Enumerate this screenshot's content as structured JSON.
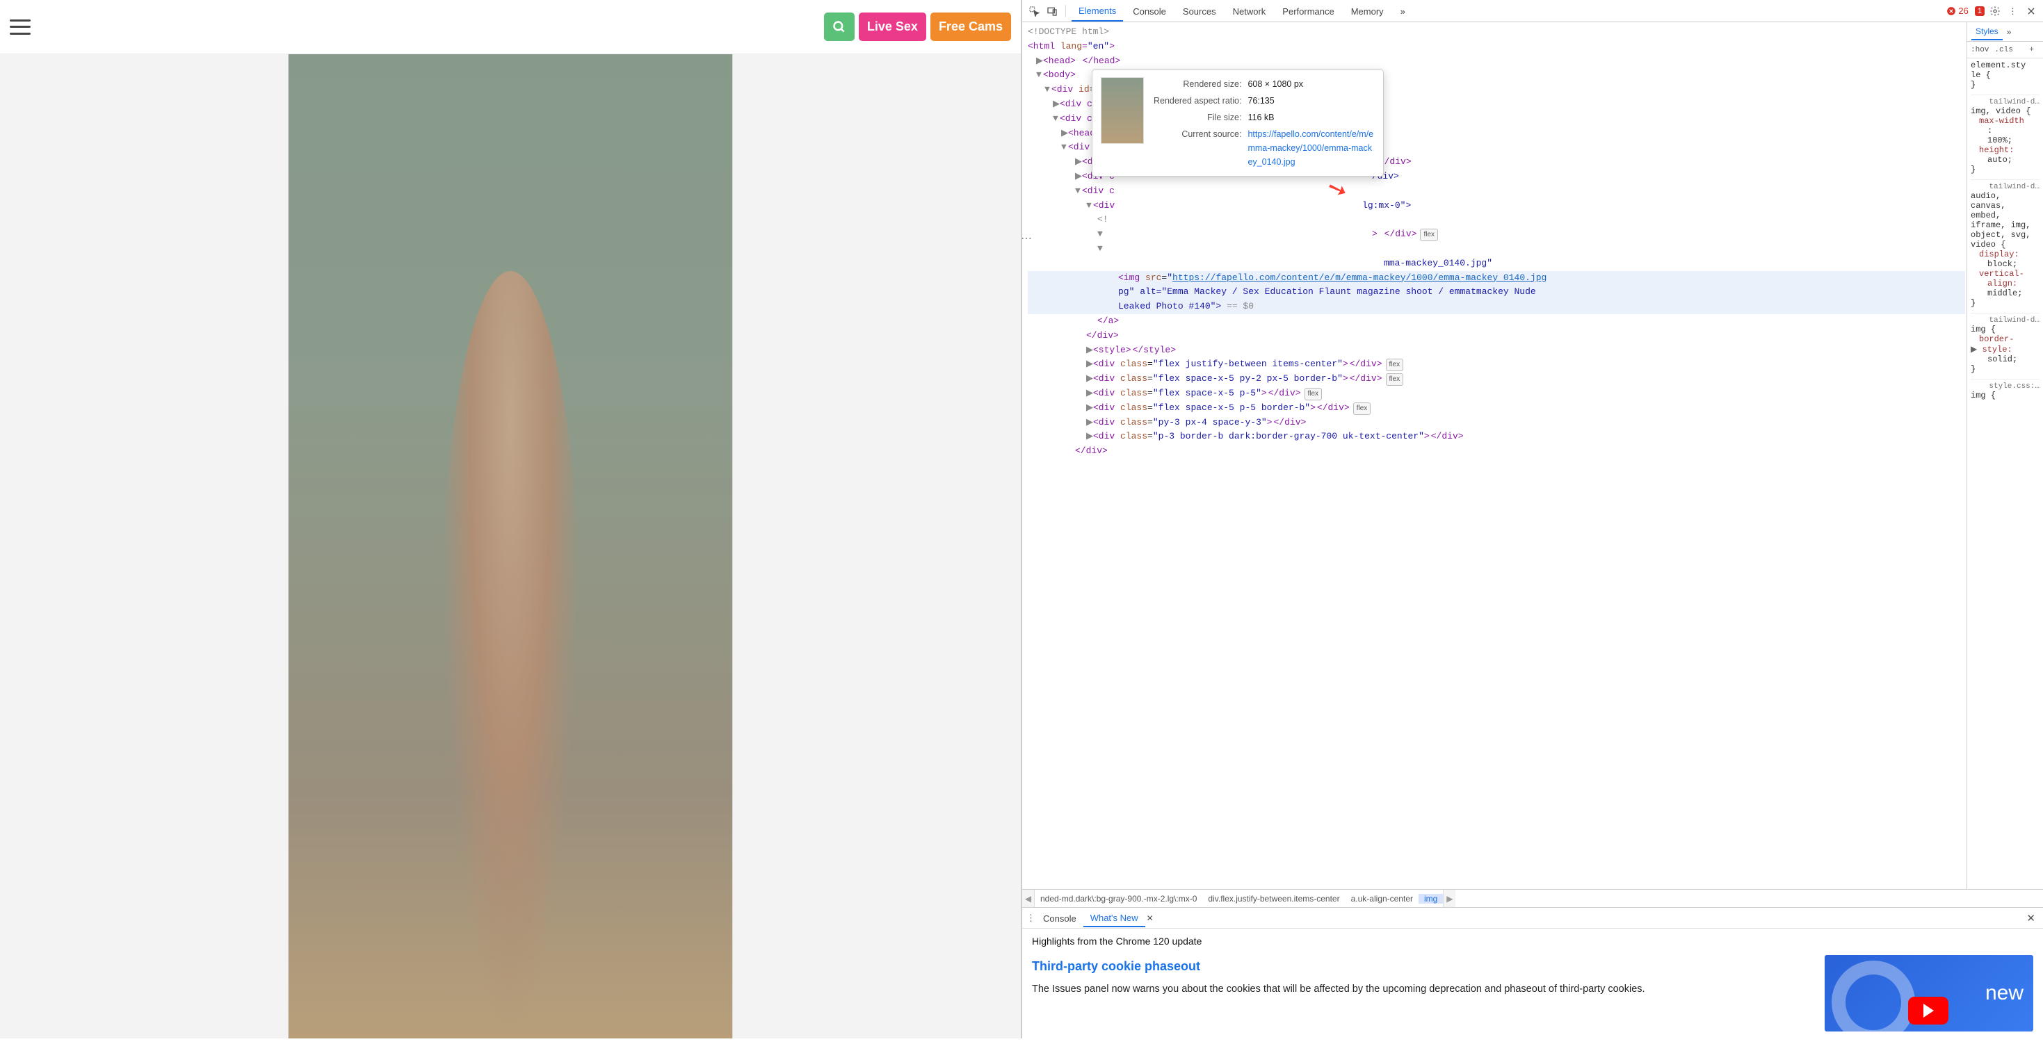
{
  "topbar": {
    "live_sex": "Live Sex",
    "free_cams": "Free Cams"
  },
  "devtools": {
    "tabs": [
      "Elements",
      "Console",
      "Sources",
      "Network",
      "Performance",
      "Memory"
    ],
    "active_tab": "Elements",
    "more": "»",
    "error_count": "26",
    "warn_count": "1",
    "styles_tab": "Styles",
    "hov": ":hov",
    "cls": ".cls"
  },
  "tooltip": {
    "rendered_size_k": "Rendered size:",
    "rendered_size_v": "608 × 1080 px",
    "aspect_k": "Rendered aspect ratio:",
    "aspect_v": "76:135",
    "filesize_k": "File size:",
    "filesize_v": "116 kB",
    "source_k": "Current source:",
    "source_v": "https://fapello.com/content/e/m/emma-mackey/1000/emma-mackey_0140.jpg"
  },
  "dom": {
    "doctype": "<!DOCTYPE html>",
    "html_open": "<html lang=\"en\">",
    "head": "<head>  </head>",
    "body_open": "<body>",
    "wrapper": "<div id=\"wrapper\">",
    "div_clas": "<div clas",
    "header": "<header>  </header>",
    "div_cl": "<div cl",
    "div_c": "<div c",
    "div_end": "</div>",
    "lg_mx": "lg:mx-0\">",
    "cut_comment": "<!",
    "after_flex": "> </div>",
    "mackey_trail": "mma-mackey_0140.jpg\"",
    "img_open": "<img src=\"",
    "img_url": "https://fapello.com/content/e/m/emma-mackey/1000/emma-mackey_0140.jpg",
    "img_alt_1": "\" alt=\"Emma Mackey / Sex Education Flaunt magazine shoot / emmatmackey Nude",
    "img_alt_2": "Leaked  Photo #140\"> ",
    "eq_dollar": "== $0",
    "a_close": "</a>",
    "div_close": "</div>",
    "style": "<style></style>",
    "flex_justify": "<div class=\"flex justify-between items-center\"></div>",
    "flex_sp1": "<div class=\"flex space-x-5 py-2 px-5 border-b\"></div>",
    "flex_sp2": "<div class=\"flex space-x-5 p-5\"></div>",
    "flex_sp3": "<div class=\"flex space-x-5 p-5 border-b\"></div>",
    "py3": "<div class=\"py-3 px-4 space-y-3\"></div>",
    "p3": "<div class=\"p-3 border-b dark:border-gray-700 uk-text-center\"></div>",
    "flex_label": "flex"
  },
  "styles_rules": {
    "elstyle1": "element.sty",
    "elstyle2": "le {",
    "origin1": "tailwind-d…",
    "r1_sel": "img, video {",
    "r1_p1": "max-width",
    "r1_v1": "100%;",
    "r1_p2": "height:",
    "r1_v2": "auto;",
    "r2_sel": "audio,\ncanvas,\nembed,\niframe, img,\nobject, svg,\nvideo {",
    "r2_p1": "display:",
    "r2_v1": "block;",
    "r2_p2": "vertical-",
    "r2_p2b": "align:",
    "r2_v2": "middle;",
    "r3_sel": "img {",
    "r3_p1": "border-",
    "r3_p1b": "style:",
    "r3_v1": "solid;",
    "origin3": "style.css:…",
    "r4_sel": "img {"
  },
  "breadcrumb": {
    "c1": "nded-md.dark\\:bg-gray-900.-mx-2.lg\\:mx-0",
    "c2": "div.flex.justify-between.items-center",
    "c3": "a.uk-align-center",
    "c4": "img"
  },
  "drawer": {
    "tabs": {
      "console": "Console",
      "whats_new": "What's New"
    },
    "headline": "Highlights from the Chrome 120 update",
    "title": "Third-party cookie phaseout",
    "body": "The Issues panel now warns you about the cookies that will be affected by the upcoming deprecation and phaseout of third-party cookies.",
    "promo": "new"
  }
}
